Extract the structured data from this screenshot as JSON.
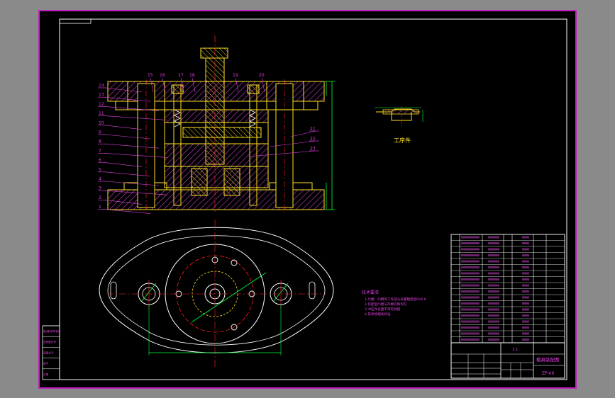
{
  "colors": {
    "background": "#000000",
    "viewport_gray": "#8a8a8a",
    "frame_magenta": "#c020c0",
    "border_white": "#ffffff",
    "part_yellow": "#ffe020",
    "hatch_magenta": "#c040c0",
    "dimension_green": "#00ff40",
    "centerline_red": "#ff2020",
    "label_magenta": "#e040e0"
  },
  "drawing": {
    "part_title": "工序件",
    "section_leader_numbers": {
      "left": [
        "14",
        "13",
        "12",
        "11",
        "10",
        "9",
        "8",
        "7",
        "6",
        "5",
        "4",
        "3",
        "2",
        "1"
      ],
      "top": [
        "15",
        "16",
        "17",
        "18",
        "19",
        "20"
      ],
      "right": [
        "21",
        "22",
        "23"
      ]
    },
    "tech_notes": {
      "heading": "技术要求",
      "lines": [
        "1.凸模、凹模的工作部分表面粗糙度Ra0.8",
        "2.装配后凸模与凹模间隙均匀",
        "3.冲压件表面不得有划痕",
        "4.其余按相关标准"
      ]
    }
  },
  "title_block": {
    "scale": "1:1",
    "drawing_name": "模具装配图",
    "drawing_number": "ZP-00"
  },
  "side_block": {
    "rows": [
      "借(通)用件登记",
      "旧底图总号",
      "底图总号",
      "签字",
      "日期"
    ]
  }
}
